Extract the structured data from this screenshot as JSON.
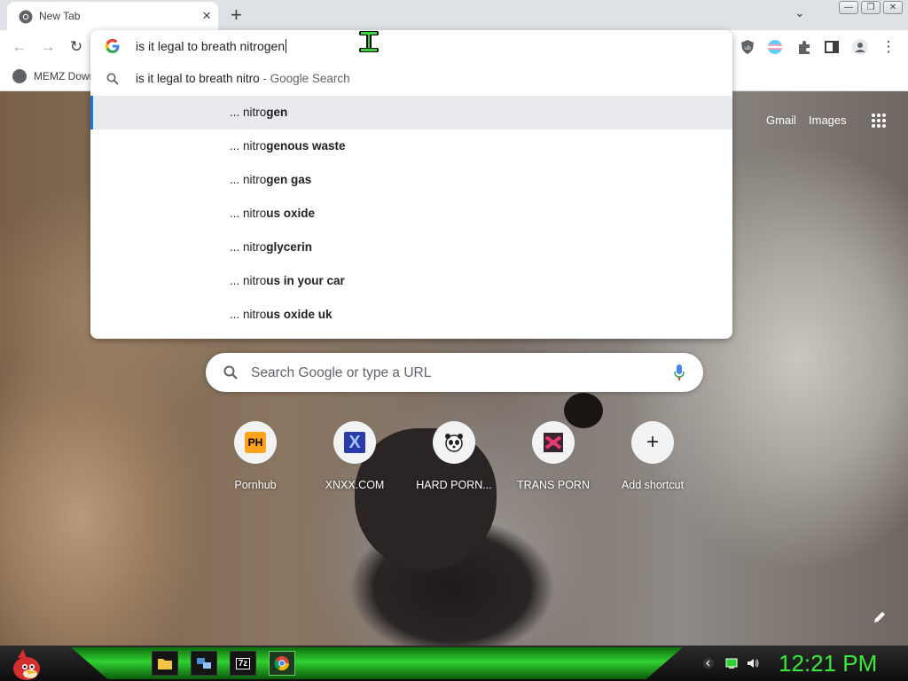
{
  "browser": {
    "tab": {
      "title": "New Tab",
      "close": "×"
    },
    "new_tab": "+",
    "window_controls": [
      "—",
      "❐",
      "✕"
    ],
    "bookmark": {
      "label": "MEMZ Down"
    }
  },
  "omnibox": {
    "query": "is it legal to breath nitrogen",
    "first_suggestion": {
      "text": "is it legal to breath nitro",
      "suffix": " - Google Search"
    },
    "suggestions": [
      {
        "prefix": "... nitro",
        "completion": "gen"
      },
      {
        "prefix": "... nitro",
        "completion": "genous waste"
      },
      {
        "prefix": "... nitro",
        "completion": "gen gas"
      },
      {
        "prefix": "... nitro",
        "completion": "us oxide"
      },
      {
        "prefix": "... nitro",
        "completion": "glycerin"
      },
      {
        "prefix": "... nitro",
        "completion": "us in your car"
      },
      {
        "prefix": "... nitro",
        "completion": "us oxide uk"
      }
    ]
  },
  "ntp": {
    "gmail": "Gmail",
    "images": "Images",
    "search_placeholder": "Search Google or type a URL",
    "shortcuts": [
      {
        "label": "Pornhub",
        "icon": "PH"
      },
      {
        "label": "XNXX.COM",
        "icon": "X"
      },
      {
        "label": "HARD PORN...",
        "icon": "panda"
      },
      {
        "label": "TRANS PORN",
        "icon": "trans"
      },
      {
        "label": "Add shortcut",
        "icon": "+"
      }
    ]
  },
  "taskbar": {
    "clock": "12:21 PM",
    "zip_label": "7z"
  },
  "colors": {
    "accent": "#1a73e8",
    "clock": "#39e939",
    "taskbar_glow": "#2fd12f"
  }
}
